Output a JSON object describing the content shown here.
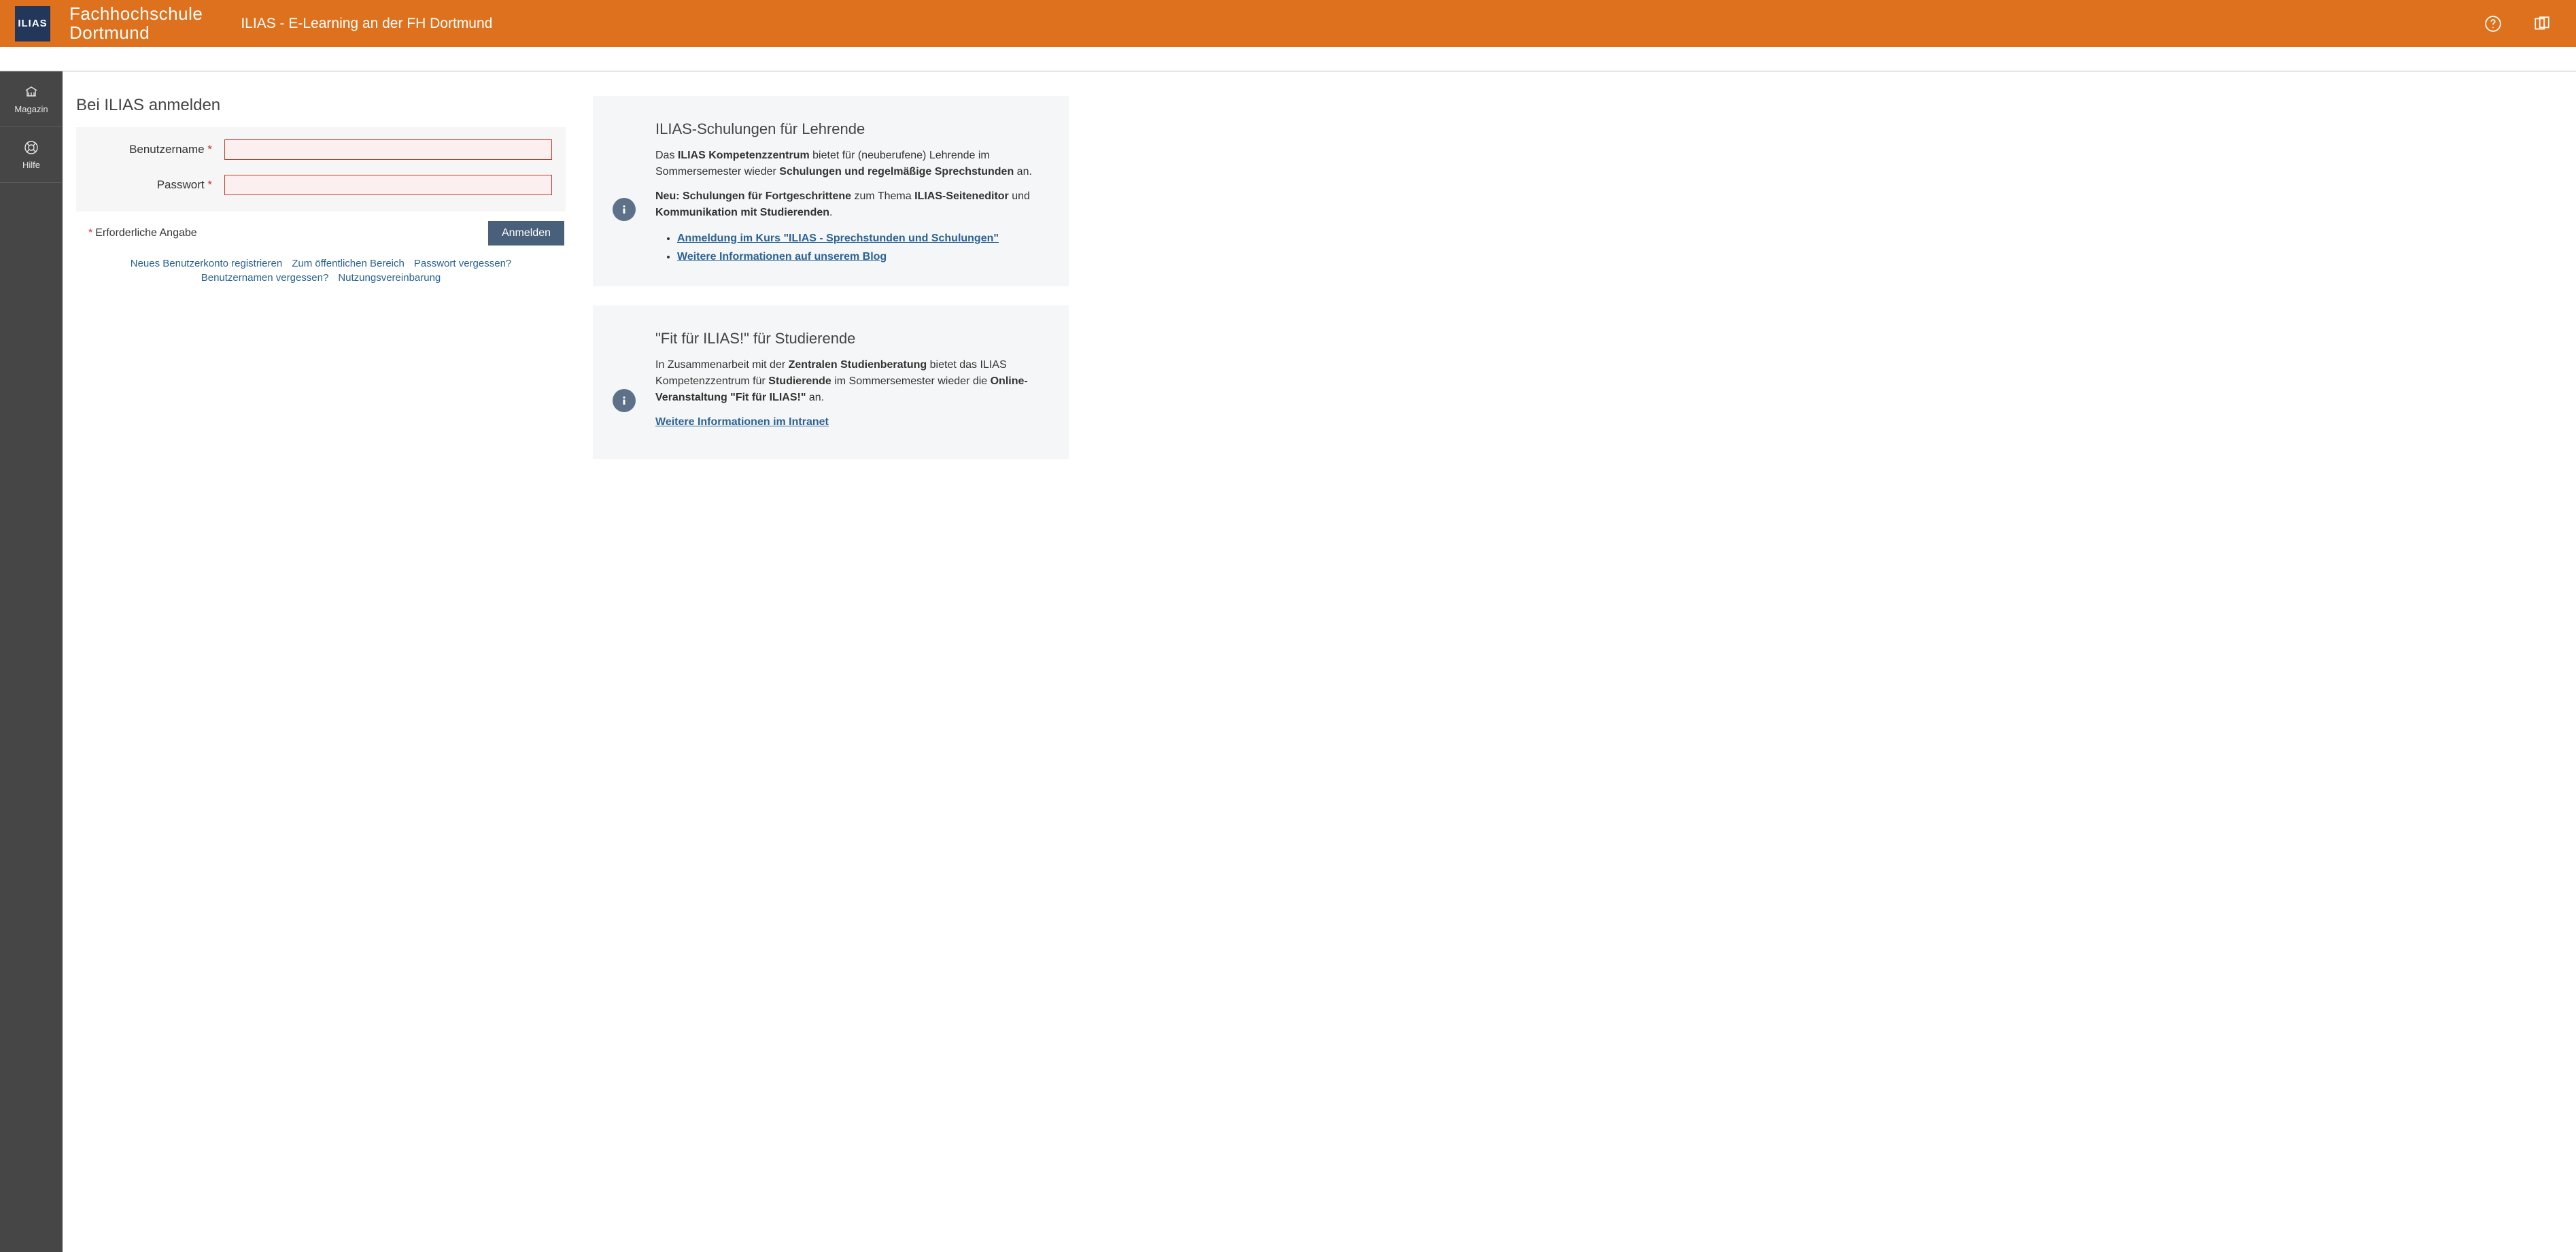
{
  "header": {
    "logo_text": "ILIAS",
    "brand_line1": "Fachhochschule",
    "brand_line2": "Dortmund",
    "title": "ILIAS - E-Learning an der FH Dortmund"
  },
  "sidebar": {
    "items": [
      {
        "label": "Magazin"
      },
      {
        "label": "Hilfe"
      }
    ]
  },
  "login": {
    "heading": "Bei ILIAS anmelden",
    "username_label": "Benutzername",
    "password_label": "Passwort",
    "required_note": "Erforderliche Angabe",
    "submit_label": "Anmelden",
    "links": {
      "register": "Neues Benutzerkonto registrieren",
      "public_area": "Zum öffentlichen Bereich",
      "forgot_password": "Passwort vergessen?",
      "forgot_username": "Benutzernamen vergessen?",
      "terms": "Nutzungsvereinbarung"
    }
  },
  "info": {
    "panel1": {
      "title": "ILIAS-Schulungen für Lehrende",
      "p1_pre": "Das ",
      "p1_b1": "ILIAS Kompetenzzentrum",
      "p1_mid": " bietet für (neuberufene) Lehrende im Sommersemester wieder ",
      "p1_b2": "Schulungen und regelmäßige Sprechstunden",
      "p1_end": " an.",
      "p2_b1": "Neu: Schulungen für Fortgeschrittene",
      "p2_mid1": " zum Thema ",
      "p2_b2": "ILIAS-Seiteneditor",
      "p2_mid2": " und ",
      "p2_b3": "Kommunikation mit Studierenden",
      "p2_end": ".",
      "link1": "Anmeldung im Kurs \"ILIAS - Sprechstunden und Schulungen\"",
      "link2": "Weitere Informationen auf unserem Blog"
    },
    "panel2": {
      "title": "\"Fit für ILIAS!\" für Studierende",
      "p1_pre": "In Zusammenarbeit mit der ",
      "p1_b1": "Zentralen Studienberatung",
      "p1_mid1": " bietet das ILIAS Kompetenzzentrum für ",
      "p1_b2": "Studierende",
      "p1_mid2": " im Sommersemester wieder die ",
      "p1_b3": "Online-Veranstaltung \"Fit für ILIAS!\"",
      "p1_end": " an.",
      "link1": "Weitere Informationen im Intranet"
    }
  }
}
